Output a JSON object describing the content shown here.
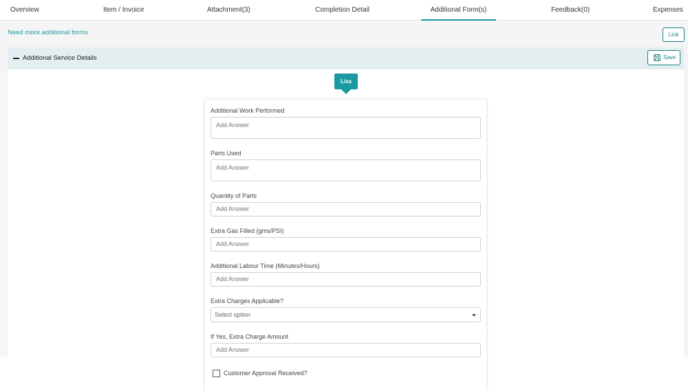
{
  "tabs": [
    {
      "label": "Overview",
      "active": false
    },
    {
      "label": "Item / Invoice",
      "active": false
    },
    {
      "label": "Attachment(3)",
      "active": false
    },
    {
      "label": "Completion Detail",
      "active": false
    },
    {
      "label": "Additional Form(s)",
      "active": true
    },
    {
      "label": "Feedback(0)",
      "active": false
    },
    {
      "label": "Expenses",
      "active": false
    }
  ],
  "toolbar": {
    "need_more_label": "Need more additional forms",
    "link_label": "Link"
  },
  "section": {
    "title": "Additional Service Details",
    "save_label": "Save"
  },
  "form": {
    "user_badge": "Lisa",
    "questions": [
      {
        "label": "Additional Work Performed",
        "placeholder": "Add Answer"
      },
      {
        "label": "Parts Used",
        "placeholder": "Add Answer"
      },
      {
        "label": "Quantity of Parts",
        "placeholder": "Add Answer"
      },
      {
        "label": "Extra Gas Filled (gms/PSI)",
        "placeholder": "Add Answer"
      },
      {
        "label": "Additional Labour Time (Minutes/Hours)",
        "placeholder": "Add Answer"
      },
      {
        "label": "Extra Charges Applicable?",
        "select_value": "Select option"
      },
      {
        "label": "If Yes, Extra Charge Amount",
        "placeholder": "Add Answer"
      }
    ],
    "checkbox_label": "Customer Approval Received?"
  },
  "colors": {
    "accent": "#1a9aa0",
    "section_bg": "#e2eef0",
    "page_bg": "#f5f5f5"
  }
}
